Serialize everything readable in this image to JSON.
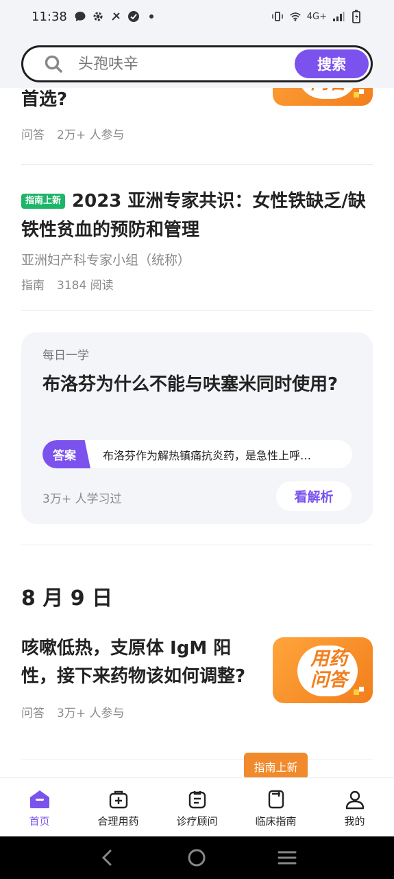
{
  "status_bar": {
    "time": "11:38",
    "network": "4G+"
  },
  "search": {
    "placeholder": "头孢呋辛",
    "button_label": "搜索"
  },
  "feed": {
    "item1": {
      "title_tail": "首选?",
      "meta_type": "问答",
      "meta_count": "2万+ 人参与",
      "thumb_text": "用药问答"
    },
    "item2": {
      "tag": "指南上新",
      "title": "2023 亚洲专家共识：女性铁缺乏/缺铁性贫血的预防和管理",
      "source": "亚洲妇产科专家小组（统称）",
      "meta_type": "指南",
      "meta_count": "3184 阅读"
    },
    "daily": {
      "label": "每日一学",
      "question": "布洛芬为什么不能与呋塞米同时使用?",
      "answer_tag": "答案",
      "answer_text": "布洛芬作为解热镇痛抗炎药，是急性上呼…",
      "count": "3万+  人学习过",
      "button": "看解析"
    },
    "date_heading": "8 月 9 日",
    "item3": {
      "title": "咳嗽低热，支原体 IgM 阳性，接下来药物该如何调整?",
      "meta_type": "问答",
      "meta_count": "3万+ 人参与",
      "thumb_text": "用药问答"
    }
  },
  "bottom_nav": {
    "badge": "指南上新",
    "items": [
      {
        "label": "首页",
        "icon": "home-icon",
        "active": true
      },
      {
        "label": "合理用药",
        "icon": "medicine-kit-icon"
      },
      {
        "label": "诊疗顾问",
        "icon": "consult-icon"
      },
      {
        "label": "临床指南",
        "icon": "guide-book-icon"
      },
      {
        "label": "我的",
        "icon": "profile-icon"
      }
    ]
  },
  "colors": {
    "accent": "#7b52ee",
    "orange": "#f08a2c",
    "green_tag": "#1db56a"
  }
}
